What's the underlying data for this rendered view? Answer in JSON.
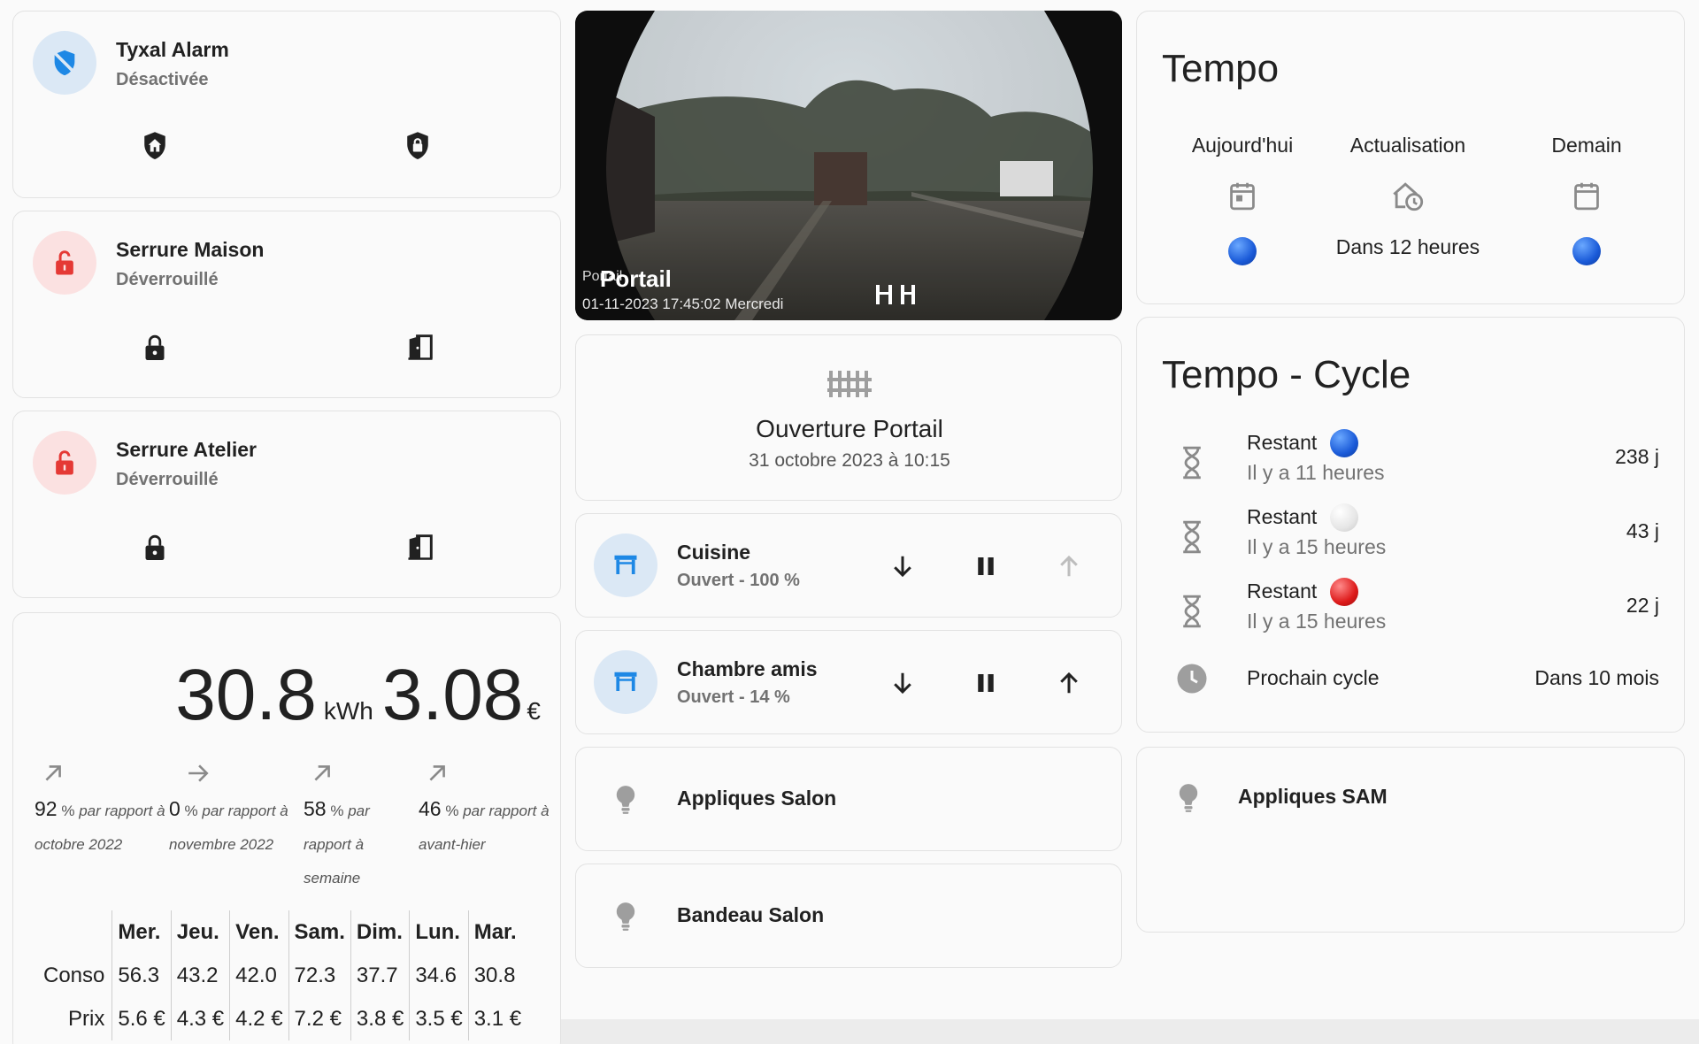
{
  "alarm": {
    "name": "Tyxal Alarm",
    "state": "Désactivée",
    "accent": "#1e88e5"
  },
  "locks": [
    {
      "name": "Serrure Maison",
      "state": "Déverrouillé"
    },
    {
      "name": "Serrure Atelier",
      "state": "Déverrouillé"
    }
  ],
  "camera": {
    "title": "Portail",
    "overlay_label": "Portail",
    "timestamp": "01-11-2023 17:45:02 Mercredi"
  },
  "portail": {
    "name": "Ouverture Portail",
    "date": "31 octobre 2023 à 10:15"
  },
  "covers": [
    {
      "name": "Cuisine",
      "state": "Ouvert - 100 %"
    },
    {
      "name": "Chambre amis",
      "state": "Ouvert - 14 %"
    }
  ],
  "lights": [
    {
      "name": "Appliques Salon"
    },
    {
      "name": "Bandeau Salon"
    },
    {
      "name": "Appliques SAM"
    }
  ],
  "energy": {
    "kwh": "30.8",
    "kwh_unit": "kWh",
    "eur": "3.08",
    "eur_unit": "€",
    "comparisons": [
      {
        "value": "92",
        "unit": "%",
        "text": "par rapport à octobre 2022",
        "icon": "arrow-up-right-icon"
      },
      {
        "value": "0",
        "unit": "%",
        "text": "par rapport à novembre 2022",
        "icon": "arrow-right-icon"
      },
      {
        "value": "58",
        "unit": "%",
        "text": "par rapport à semaine",
        "icon": "arrow-up-right-icon"
      },
      {
        "value": "46",
        "unit": "%",
        "text": "par rapport à avant-hier",
        "icon": "arrow-up-right-icon"
      }
    ],
    "days": [
      "Mer.",
      "Jeu.",
      "Ven.",
      "Sam.",
      "Dim.",
      "Lun.",
      "Mar."
    ],
    "conso_label": "Conso",
    "conso": [
      "56.3",
      "43.2",
      "42.0",
      "72.3",
      "37.7",
      "34.6",
      "30.8"
    ],
    "prix_label": "Prix",
    "prix": [
      "5.6 €",
      "4.3 €",
      "4.2 €",
      "7.2 €",
      "3.8 €",
      "3.5 €",
      "3.1 €"
    ]
  },
  "tempo": {
    "title": "Tempo",
    "columns": [
      "Aujourd'hui",
      "Actualisation",
      "Demain"
    ],
    "refresh": "Dans 12 heures",
    "today_color": "blue",
    "tomorrow_color": "blue"
  },
  "tempo_cycle": {
    "title": "Tempo - Cycle",
    "rows": [
      {
        "label": "Restant",
        "ago": "Il y a 11 heures",
        "value": "238 j",
        "color": "blue"
      },
      {
        "label": "Restant",
        "ago": "Il y a 15 heures",
        "value": "43 j",
        "color": "white"
      },
      {
        "label": "Restant",
        "ago": "Il y a 15 heures",
        "value": "22 j",
        "color": "red"
      }
    ],
    "next_label": "Prochain cycle",
    "next_value": "Dans 10 mois"
  }
}
